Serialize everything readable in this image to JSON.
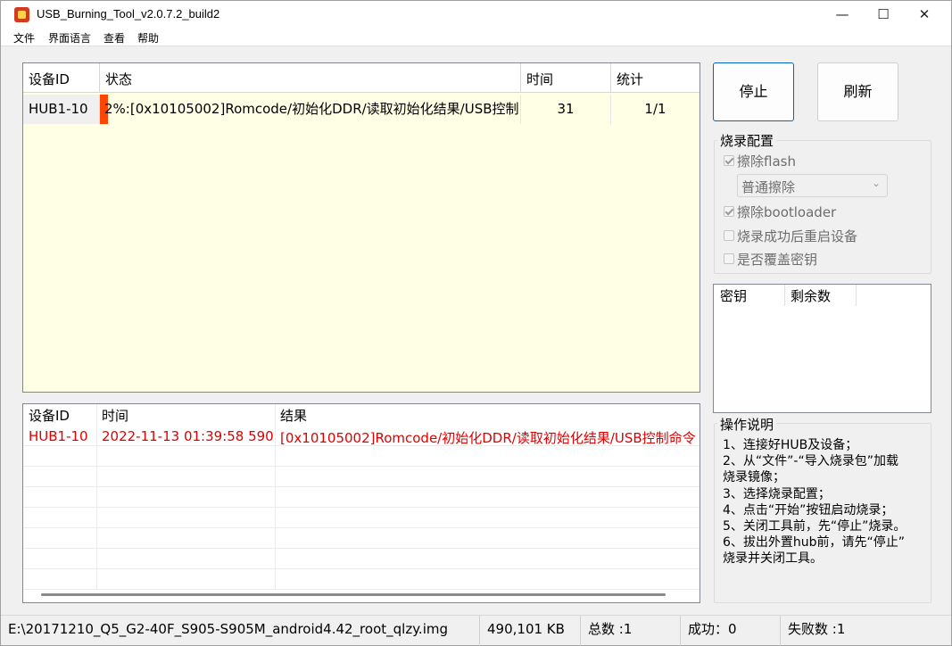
{
  "window": {
    "title": "USB_Burning_Tool_v2.0.7.2_build2",
    "minimize": "—",
    "maximize": "☐",
    "close": "✕"
  },
  "menu": [
    "文件",
    "界面语言",
    "查看",
    "帮助"
  ],
  "device_table": {
    "headers": [
      "设备ID",
      "状态",
      "时间",
      "统计"
    ],
    "rows": [
      {
        "id": "HUB1-10",
        "status": "2%:[0x10105002]Romcode/初始化DDR/读取初始化结果/USB控制",
        "time": "31",
        "stats": "1/1",
        "progress": 0.02
      }
    ]
  },
  "log_table": {
    "headers": [
      "设备ID",
      "时间",
      "结果"
    ],
    "rows": [
      {
        "id": "HUB1-10",
        "time": "2022-11-13 01:39:58 590",
        "result": "[0x10105002]Romcode/初始化DDR/读取初始化结果/USB控制命令"
      }
    ]
  },
  "buttons": {
    "stop": "停止",
    "refresh": "刷新"
  },
  "burn_config": {
    "title": "烧录配置",
    "erase_flash": "擦除flash",
    "erase_mode": "普通擦除",
    "erase_bootloader": "擦除bootloader",
    "reboot_after": "烧录成功后重启设备",
    "overwrite_key": "是否覆盖密钥"
  },
  "key_table": {
    "headers": [
      "密钥",
      "剩余数"
    ]
  },
  "instructions": {
    "title": "操作说明",
    "lines": [
      "1、连接好HUB及设备；",
      "2、从“文件”-“导入烧录包”加载",
      "烧录镜像；",
      "3、选择烧录配置；",
      "4、点击“开始”按钮启动烧录；",
      "5、关闭工具前，先“停止”烧录。",
      "6、拔出外置hub前，请先“停止”",
      "烧录并关闭工具。"
    ]
  },
  "status_bar": {
    "path": "E:\\20171210_Q5_G2-40F_S905-S905M_android4.42_root_qlzy.img",
    "size": "490,101 KB",
    "total": "总数 :1",
    "success": "成功：0",
    "failed": "失败数 :1"
  },
  "colors": {
    "error": "#e00000",
    "progress": "#ff4500",
    "row_bg": "#ffffe6"
  }
}
